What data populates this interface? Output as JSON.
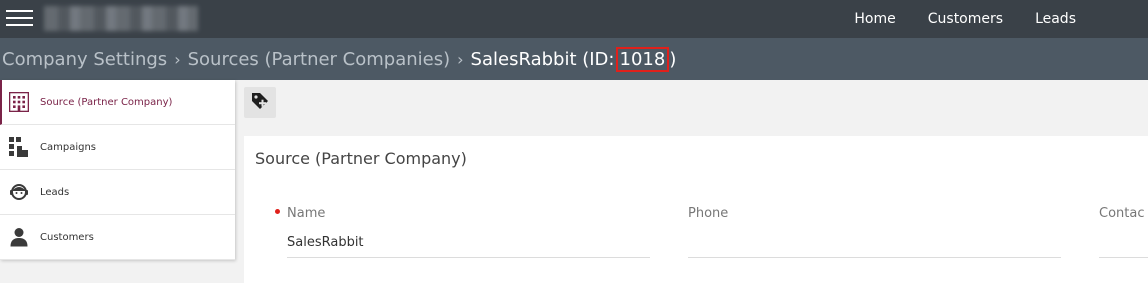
{
  "topbar": {
    "nav": [
      {
        "label": "Home"
      },
      {
        "label": "Customers"
      },
      {
        "label": "Leads"
      }
    ]
  },
  "breadcrumb": {
    "items": [
      {
        "label": "Company Settings"
      },
      {
        "label": "Sources (Partner Companies)"
      }
    ],
    "separator": "›",
    "current_prefix": "SalesRabbit (ID:",
    "current_id": "1018",
    "current_suffix": ")"
  },
  "sidebar": {
    "items": [
      {
        "label": "Source (Partner Company)",
        "icon": "building-icon",
        "active": true
      },
      {
        "label": "Campaigns",
        "icon": "campaign-icon",
        "active": false
      },
      {
        "label": "Leads",
        "icon": "lead-face-icon",
        "active": false
      },
      {
        "label": "Customers",
        "icon": "person-icon",
        "active": false
      }
    ]
  },
  "toolbar": {
    "icon": "add-tag-icon"
  },
  "card": {
    "title": "Source (Partner Company)",
    "fields": [
      {
        "label": "Name",
        "value": "SalesRabbit",
        "required": true
      },
      {
        "label": "Phone",
        "value": "",
        "required": false
      },
      {
        "label": "Contac",
        "value": "",
        "required": false
      }
    ]
  },
  "colors": {
    "topbar": "#3a4148",
    "breadcrumb_bar": "#4d5964",
    "accent": "#7a2348",
    "highlight_box": "#e0201b"
  }
}
